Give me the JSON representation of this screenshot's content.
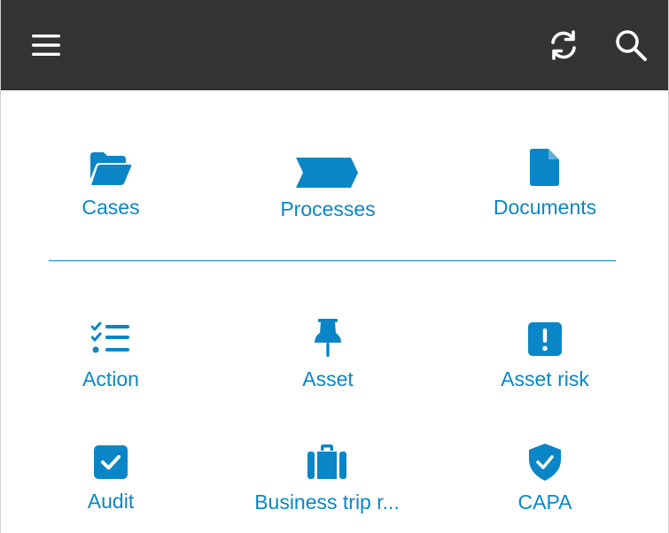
{
  "toolbar": {
    "menu_icon": "hamburger-menu-icon",
    "refresh_icon": "refresh-icon",
    "search_icon": "search-icon"
  },
  "colors": {
    "topbar": "#333333",
    "accent": "#0a86c7",
    "background": "#ffffff"
  },
  "primary_tiles": [
    {
      "label": "Cases",
      "icon": "folder-open-icon"
    },
    {
      "label": "Processes",
      "icon": "process-chevron-icon"
    },
    {
      "label": "Documents",
      "icon": "document-icon"
    }
  ],
  "object_tiles": [
    {
      "label": "Action",
      "icon": "checklist-icon"
    },
    {
      "label": "Asset",
      "icon": "pushpin-icon"
    },
    {
      "label": "Asset risk",
      "icon": "exclamation-square-icon"
    },
    {
      "label": "Audit",
      "icon": "check-square-icon"
    },
    {
      "label": "Business trip r...",
      "icon": "suitcase-icon"
    },
    {
      "label": "CAPA",
      "icon": "shield-check-icon"
    }
  ]
}
